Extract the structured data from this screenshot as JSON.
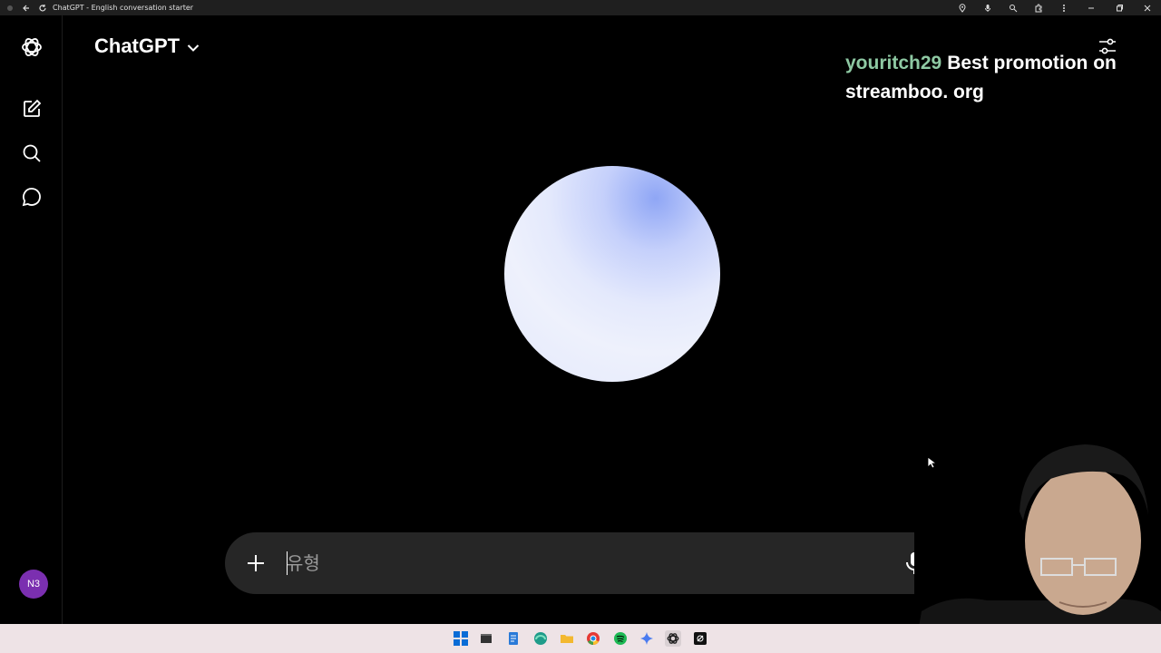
{
  "browser": {
    "tab_title": "ChatGPT - English conversation starter"
  },
  "sidebar": {
    "items": [
      {
        "icon": "new-chat-icon"
      },
      {
        "icon": "search-icon"
      },
      {
        "icon": "chat-bubble-icon"
      }
    ],
    "avatar_initials": "N3"
  },
  "header": {
    "model_name": "ChatGPT"
  },
  "stream_overlay": {
    "username": "youritch29",
    "message": "Best promotion on streamboo. org"
  },
  "composer": {
    "placeholder": "유형"
  },
  "colors": {
    "avatar": "#7b2fb0",
    "overlay_username": "#8ec9a3",
    "composer_bg": "#262626",
    "taskbar_bg": "#eee3e6"
  },
  "taskbar": {
    "apps": [
      "windows-start-icon",
      "terminal-icon",
      "notepad-icon",
      "edge-icon",
      "file-explorer-icon",
      "chrome-icon",
      "spotify-icon",
      "gemini-icon",
      "chatgpt-icon",
      "capcut-icon"
    ]
  }
}
